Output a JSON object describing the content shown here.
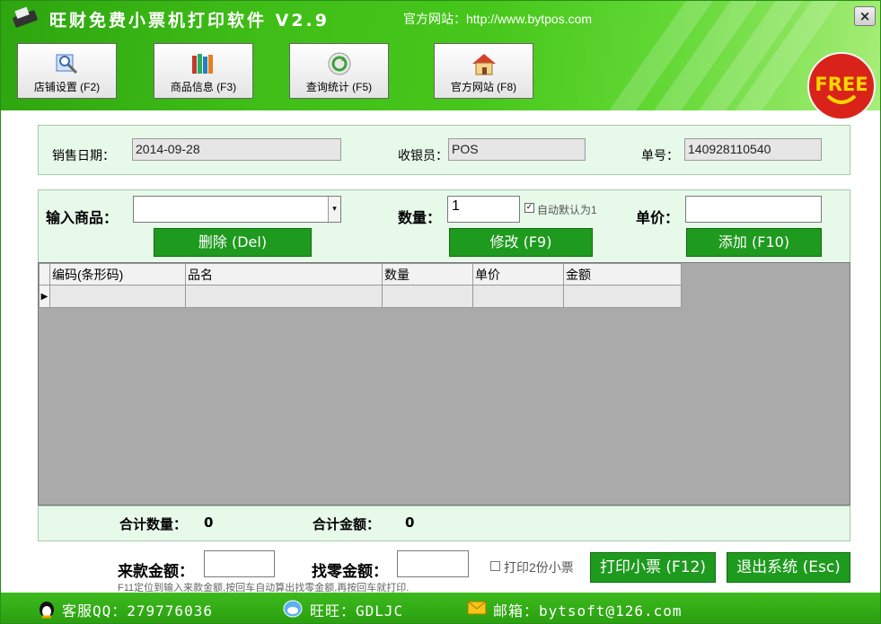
{
  "titlebar": {
    "title": "旺财免费小票机打印软件 V2.9",
    "site": "官方网站：http://www.bytpos.com",
    "close": "×"
  },
  "toolbar": [
    {
      "label": "店铺设置 (F2)",
      "icon": "shop-settings-icon"
    },
    {
      "label": "商品信息 (F3)",
      "icon": "books-icon"
    },
    {
      "label": "查询统计 (F5)",
      "icon": "refresh-icon"
    },
    {
      "label": "官方网站 (F8)",
      "icon": "home-icon"
    }
  ],
  "badge": "FREE",
  "sale": {
    "date_label": "销售日期：",
    "date": "2014-09-28",
    "cashier_label": "收银员：",
    "cashier": "POS",
    "order_label": "单号：",
    "order_no": "140928110540"
  },
  "entry": {
    "product_label": "输入商品：",
    "product_value": "",
    "qty_label": "数量：",
    "qty_value": "1",
    "auto_label": "自动默认为1",
    "price_label": "单价：",
    "price_value": ""
  },
  "buttons": {
    "delete": "删除 (Del)",
    "modify": "修改 (F9)",
    "add": "添加 (F10)",
    "print": "打印小票 (F12)",
    "exit": "退出系统 (Esc)"
  },
  "table": {
    "columns": [
      "编码(条形码)",
      "品名",
      "数量",
      "单价",
      "金额"
    ],
    "rows": [
      [
        "",
        "",
        "",
        "",
        ""
      ]
    ]
  },
  "totals": {
    "qty_label": "合计数量：",
    "qty": "0",
    "amount_label": "合计金额：",
    "amount": "0"
  },
  "payment": {
    "received_label": "来款金额：",
    "received": "",
    "change_label": "找零金额：",
    "change": "",
    "print2_label": "打印2份小票",
    "hint": "F11定位到输入来款金额,按回车自动算出找零金额,再按回车就打印."
  },
  "status": {
    "qq": "客服QQ：279776036",
    "wangwang": "旺旺：GDLJC",
    "email": "邮箱：bytsoft@126.com"
  }
}
